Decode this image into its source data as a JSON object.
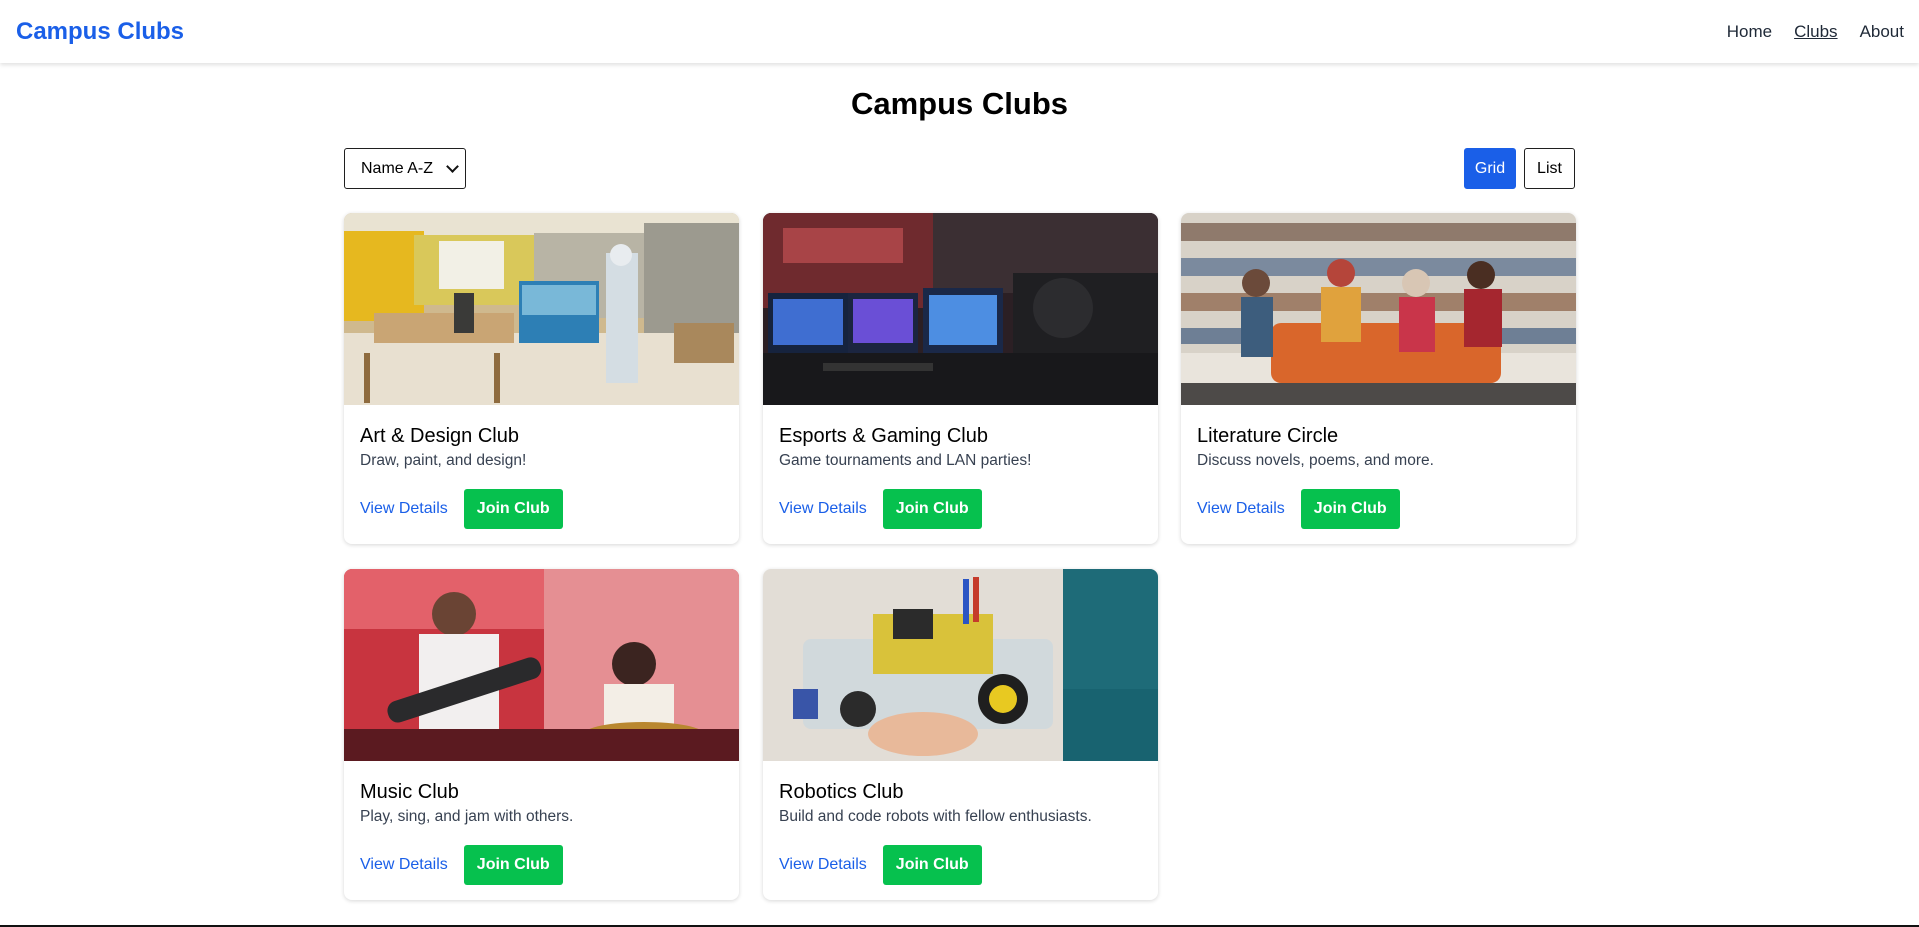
{
  "navbar": {
    "brand": "Campus Clubs",
    "links": [
      "Home",
      "Clubs",
      "About"
    ],
    "active_link": "Clubs"
  },
  "page": {
    "title": "Campus Clubs",
    "sort": {
      "selected": "Name A-Z"
    },
    "view_toggle": {
      "grid_label": "Grid",
      "list_label": "List",
      "active": "Grid"
    }
  },
  "clubs": [
    {
      "name": "Art & Design Club",
      "description": "Draw, paint, and design!",
      "details_label": "View Details",
      "join_label": "Join Club",
      "image": "art-studio-photo"
    },
    {
      "name": "Esports & Gaming Club",
      "description": "Game tournaments and LAN parties!",
      "details_label": "View Details",
      "join_label": "Join Club",
      "image": "esports-lab-photo"
    },
    {
      "name": "Literature Circle",
      "description": "Discuss novels, poems, and more.",
      "details_label": "View Details",
      "join_label": "Join Club",
      "image": "library-readers-photo"
    },
    {
      "name": "Music Club",
      "description": "Play, sing, and jam with others.",
      "details_label": "View Details",
      "join_label": "Join Club",
      "image": "music-band-photo"
    },
    {
      "name": "Robotics Club",
      "description": "Build and code robots with fellow enthusiasts.",
      "details_label": "View Details",
      "join_label": "Join Club",
      "image": "robot-car-photo"
    }
  ],
  "colors": {
    "primary": "#1a5fe8",
    "join": "#06c14e",
    "text": "#111827",
    "muted": "#374151"
  }
}
